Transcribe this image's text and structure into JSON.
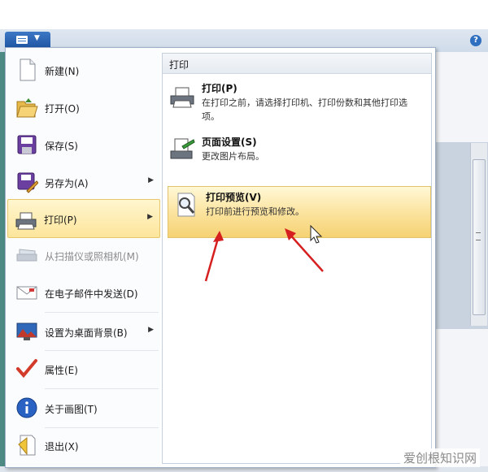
{
  "left_menu": {
    "items": [
      {
        "label": "新建(N)",
        "icon": "new-file-icon"
      },
      {
        "label": "打开(O)",
        "icon": "open-folder-icon"
      },
      {
        "label": "保存(S)",
        "icon": "save-icon"
      },
      {
        "label": "另存为(A)",
        "icon": "save-as-icon",
        "submenu_arrow": "▶"
      },
      {
        "label": "打印(P)",
        "icon": "printer-icon",
        "submenu_arrow": "▶",
        "highlighted": true
      },
      {
        "label": "从扫描仪或照相机(M)",
        "icon": "scanner-icon",
        "disabled": true
      },
      {
        "label": "在电子邮件中发送(D)",
        "icon": "email-icon"
      },
      {
        "label": "设置为桌面背景(B)",
        "icon": "desktop-background-icon",
        "submenu_arrow": "▶"
      },
      {
        "label": "属性(E)",
        "icon": "properties-check-icon"
      },
      {
        "label": "关于画图(T)",
        "icon": "info-icon"
      },
      {
        "label": "退出(X)",
        "icon": "exit-icon"
      }
    ]
  },
  "submenu": {
    "header": "打印",
    "items": [
      {
        "title": "打印(P)",
        "desc": "在打印之前，请选择打印机、打印份数和其他打印选项。",
        "icon": "printer-icon"
      },
      {
        "title": "页面设置(S)",
        "desc": "更改图片布局。",
        "icon": "page-setup-icon"
      },
      {
        "title": "打印预览(V)",
        "desc": "打印前进行预览和修改。",
        "icon": "print-preview-icon",
        "highlighted": true
      }
    ]
  },
  "help_icon": "?",
  "watermark": "爱创根知识网",
  "colors": {
    "highlight": "#fde59b",
    "annotation_arrow": "#d62020",
    "accent": "#2e6fc0"
  }
}
